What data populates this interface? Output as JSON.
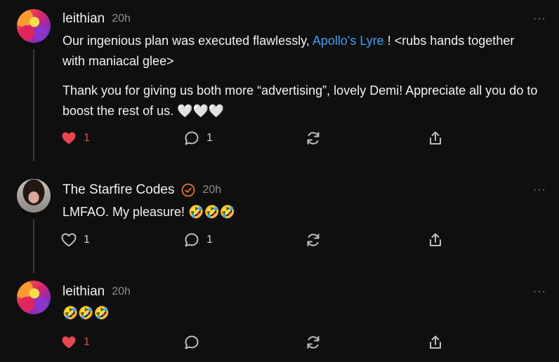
{
  "comments": [
    {
      "author": "leithian",
      "time": "20h",
      "verified": false,
      "paragraphs": [
        {
          "before": "Our ingenious plan was executed flawlessly, ",
          "link": "Apollo's Lyre",
          "after": " ! <rubs hands together with maniacal glee>"
        },
        {
          "text": "Thank you for giving us both more “advertising”, lovely Demi! Appreciate all you do to boost the rest of us. 🤍🤍🤍"
        }
      ],
      "liked": true,
      "like_count": "1",
      "reply_count": "1"
    },
    {
      "author": "The Starfire Codes",
      "time": "20h",
      "verified": true,
      "text": "LMFAO. My pleasure! 🤣🤣🤣",
      "liked": false,
      "like_count": "1",
      "reply_count": "1"
    },
    {
      "author": "leithian",
      "time": "20h",
      "verified": false,
      "text": "🤣🤣🤣",
      "liked": true,
      "like_count": "1",
      "reply_count": ""
    }
  ],
  "more_label": "···",
  "colors": {
    "like": "#e8464e",
    "link": "#3e9bf0",
    "verified": "#f0712b",
    "muted": "#8e8e8e"
  },
  "icons": {
    "like": "heart-icon",
    "reply": "comment-icon",
    "restack": "restack-icon",
    "share": "share-icon",
    "more": "more-icon",
    "verified": "verified-badge-icon"
  }
}
